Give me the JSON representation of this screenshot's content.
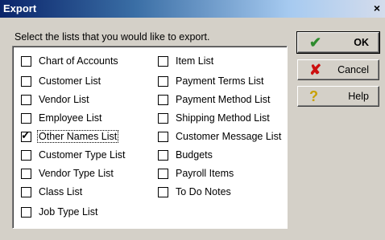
{
  "window": {
    "title": "Export",
    "close_glyph": "×"
  },
  "instruction": "Select the lists that you would like to export.",
  "lists": {
    "left": [
      {
        "label": "Chart of Accounts",
        "checked": false
      },
      {
        "label": "Customer List",
        "checked": false
      },
      {
        "label": "Vendor List",
        "checked": false
      },
      {
        "label": "Employee List",
        "checked": false
      },
      {
        "label": "Other Names List",
        "checked": true,
        "focused": true
      },
      {
        "label": "Customer Type List",
        "checked": false
      },
      {
        "label": "Vendor Type List",
        "checked": false
      },
      {
        "label": "Class List",
        "checked": false
      },
      {
        "label": "Job Type List",
        "checked": false
      }
    ],
    "right": [
      {
        "label": "Item List",
        "checked": false
      },
      {
        "label": "Payment Terms List",
        "checked": false
      },
      {
        "label": "Payment Method List",
        "checked": false
      },
      {
        "label": "Shipping Method List",
        "checked": false
      },
      {
        "label": "Customer Message List",
        "checked": false
      },
      {
        "label": "Budgets",
        "checked": false
      },
      {
        "label": "Payroll Items",
        "checked": false
      },
      {
        "label": "To Do Notes",
        "checked": false
      }
    ]
  },
  "buttons": {
    "ok": {
      "label": "OK",
      "icon": "green-check-icon",
      "color": "#2e8b2e"
    },
    "cancel": {
      "label": "Cancel",
      "icon": "red-x-icon",
      "color": "#cc1010"
    },
    "help": {
      "label": "Help",
      "icon": "question-icon",
      "color": "#c8a000"
    }
  },
  "check_glyph": "✓"
}
